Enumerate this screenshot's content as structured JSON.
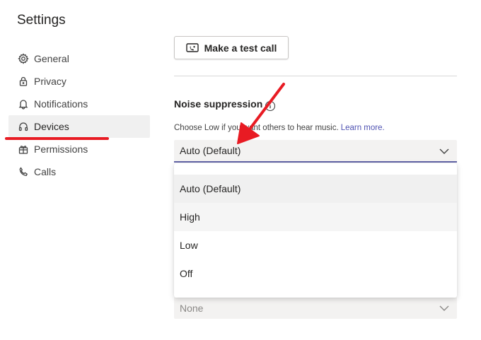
{
  "page": {
    "title": "Settings"
  },
  "sidebar": {
    "items": [
      {
        "label": "General",
        "icon": "gear-icon",
        "active": false
      },
      {
        "label": "Privacy",
        "icon": "lock-icon",
        "active": false
      },
      {
        "label": "Notifications",
        "icon": "bell-icon",
        "active": false
      },
      {
        "label": "Devices",
        "icon": "headset-icon",
        "active": true
      },
      {
        "label": "Permissions",
        "icon": "gift-icon",
        "active": false
      },
      {
        "label": "Calls",
        "icon": "phone-icon",
        "active": false
      }
    ]
  },
  "main": {
    "test_call_label": "Make a test call",
    "noise": {
      "title": "Noise suppression",
      "hint": "Choose Low if you want others to hear music.",
      "learn_more": "Learn more.",
      "selected": "Auto (Default)",
      "options": [
        "Auto (Default)",
        "High",
        "Low",
        "Off"
      ]
    },
    "secondary_select_value": "None"
  },
  "colors": {
    "accent": "#6264a7",
    "annotation_red": "#e81b23",
    "link": "#4f52b2"
  }
}
